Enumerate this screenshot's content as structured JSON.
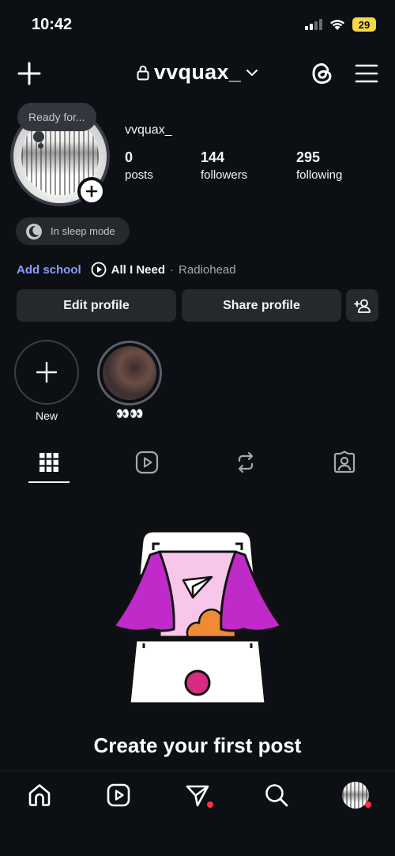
{
  "status_bar": {
    "time": "10:42",
    "battery": "29",
    "icons": [
      "signal-icon",
      "wifi-icon",
      "battery-icon"
    ]
  },
  "header": {
    "username": "vvquax_",
    "icons": [
      "plus-icon",
      "lock-icon",
      "chevron-down-icon",
      "threads-icon",
      "menu-icon"
    ]
  },
  "profile": {
    "note": "Ready for...",
    "display_name": "vvquax_",
    "stats": {
      "posts": {
        "value": "0",
        "label": "posts"
      },
      "followers": {
        "value": "144",
        "label": "followers"
      },
      "following": {
        "value": "295",
        "label": "following"
      }
    },
    "sleep_status": "In sleep mode",
    "add_school": "Add school",
    "music": {
      "title": "All I Need",
      "separator": "·",
      "artist": "Radiohead"
    }
  },
  "actions": {
    "edit_profile": "Edit profile",
    "share_profile": "Share profile"
  },
  "highlights": [
    {
      "label": "New"
    },
    {
      "label": "👀👀"
    }
  ],
  "tabs": [
    "grid-icon",
    "reels-icon",
    "reposts-icon",
    "tagged-icon"
  ],
  "empty_state": {
    "title": "Create your first post"
  },
  "bottom_nav": [
    "home-icon",
    "reels-icon",
    "direct-icon",
    "search-icon",
    "profile-avatar"
  ],
  "colors": {
    "background": "#0c1014",
    "button": "#25292e",
    "link": "#8b9bff",
    "notification": "#ff3040",
    "illustration_purple": "#c02ac8",
    "illustration_orange": "#f08a35",
    "illustration_pink": "#f7c6e9"
  }
}
